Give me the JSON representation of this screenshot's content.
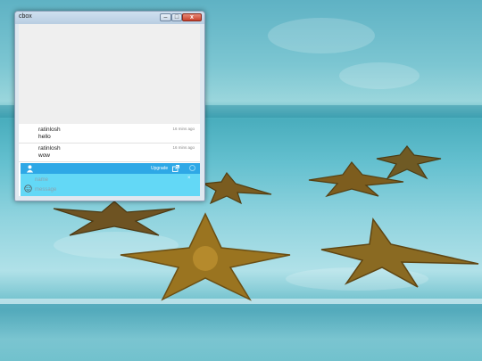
{
  "window": {
    "title": "cbox",
    "close_glyph": "x"
  },
  "messages": [
    {
      "user": "ratinlosh",
      "text": "hello",
      "time": "16 mins ago"
    },
    {
      "user": "ratinlosh",
      "text": "wow",
      "time": "16 mins ago"
    }
  ],
  "toolbar": {
    "upgrade_label": "Upgrade",
    "icons": [
      "user-icon",
      "external-link-icon",
      "circle-icon"
    ]
  },
  "form": {
    "name_placeholder": "name",
    "message_placeholder": "message",
    "clear_glyph": "×"
  },
  "colors": {
    "bar": "#2ea8e6",
    "form": "#63d8f6",
    "titlebar": "#c2d5e8",
    "close": "#c8412c"
  }
}
